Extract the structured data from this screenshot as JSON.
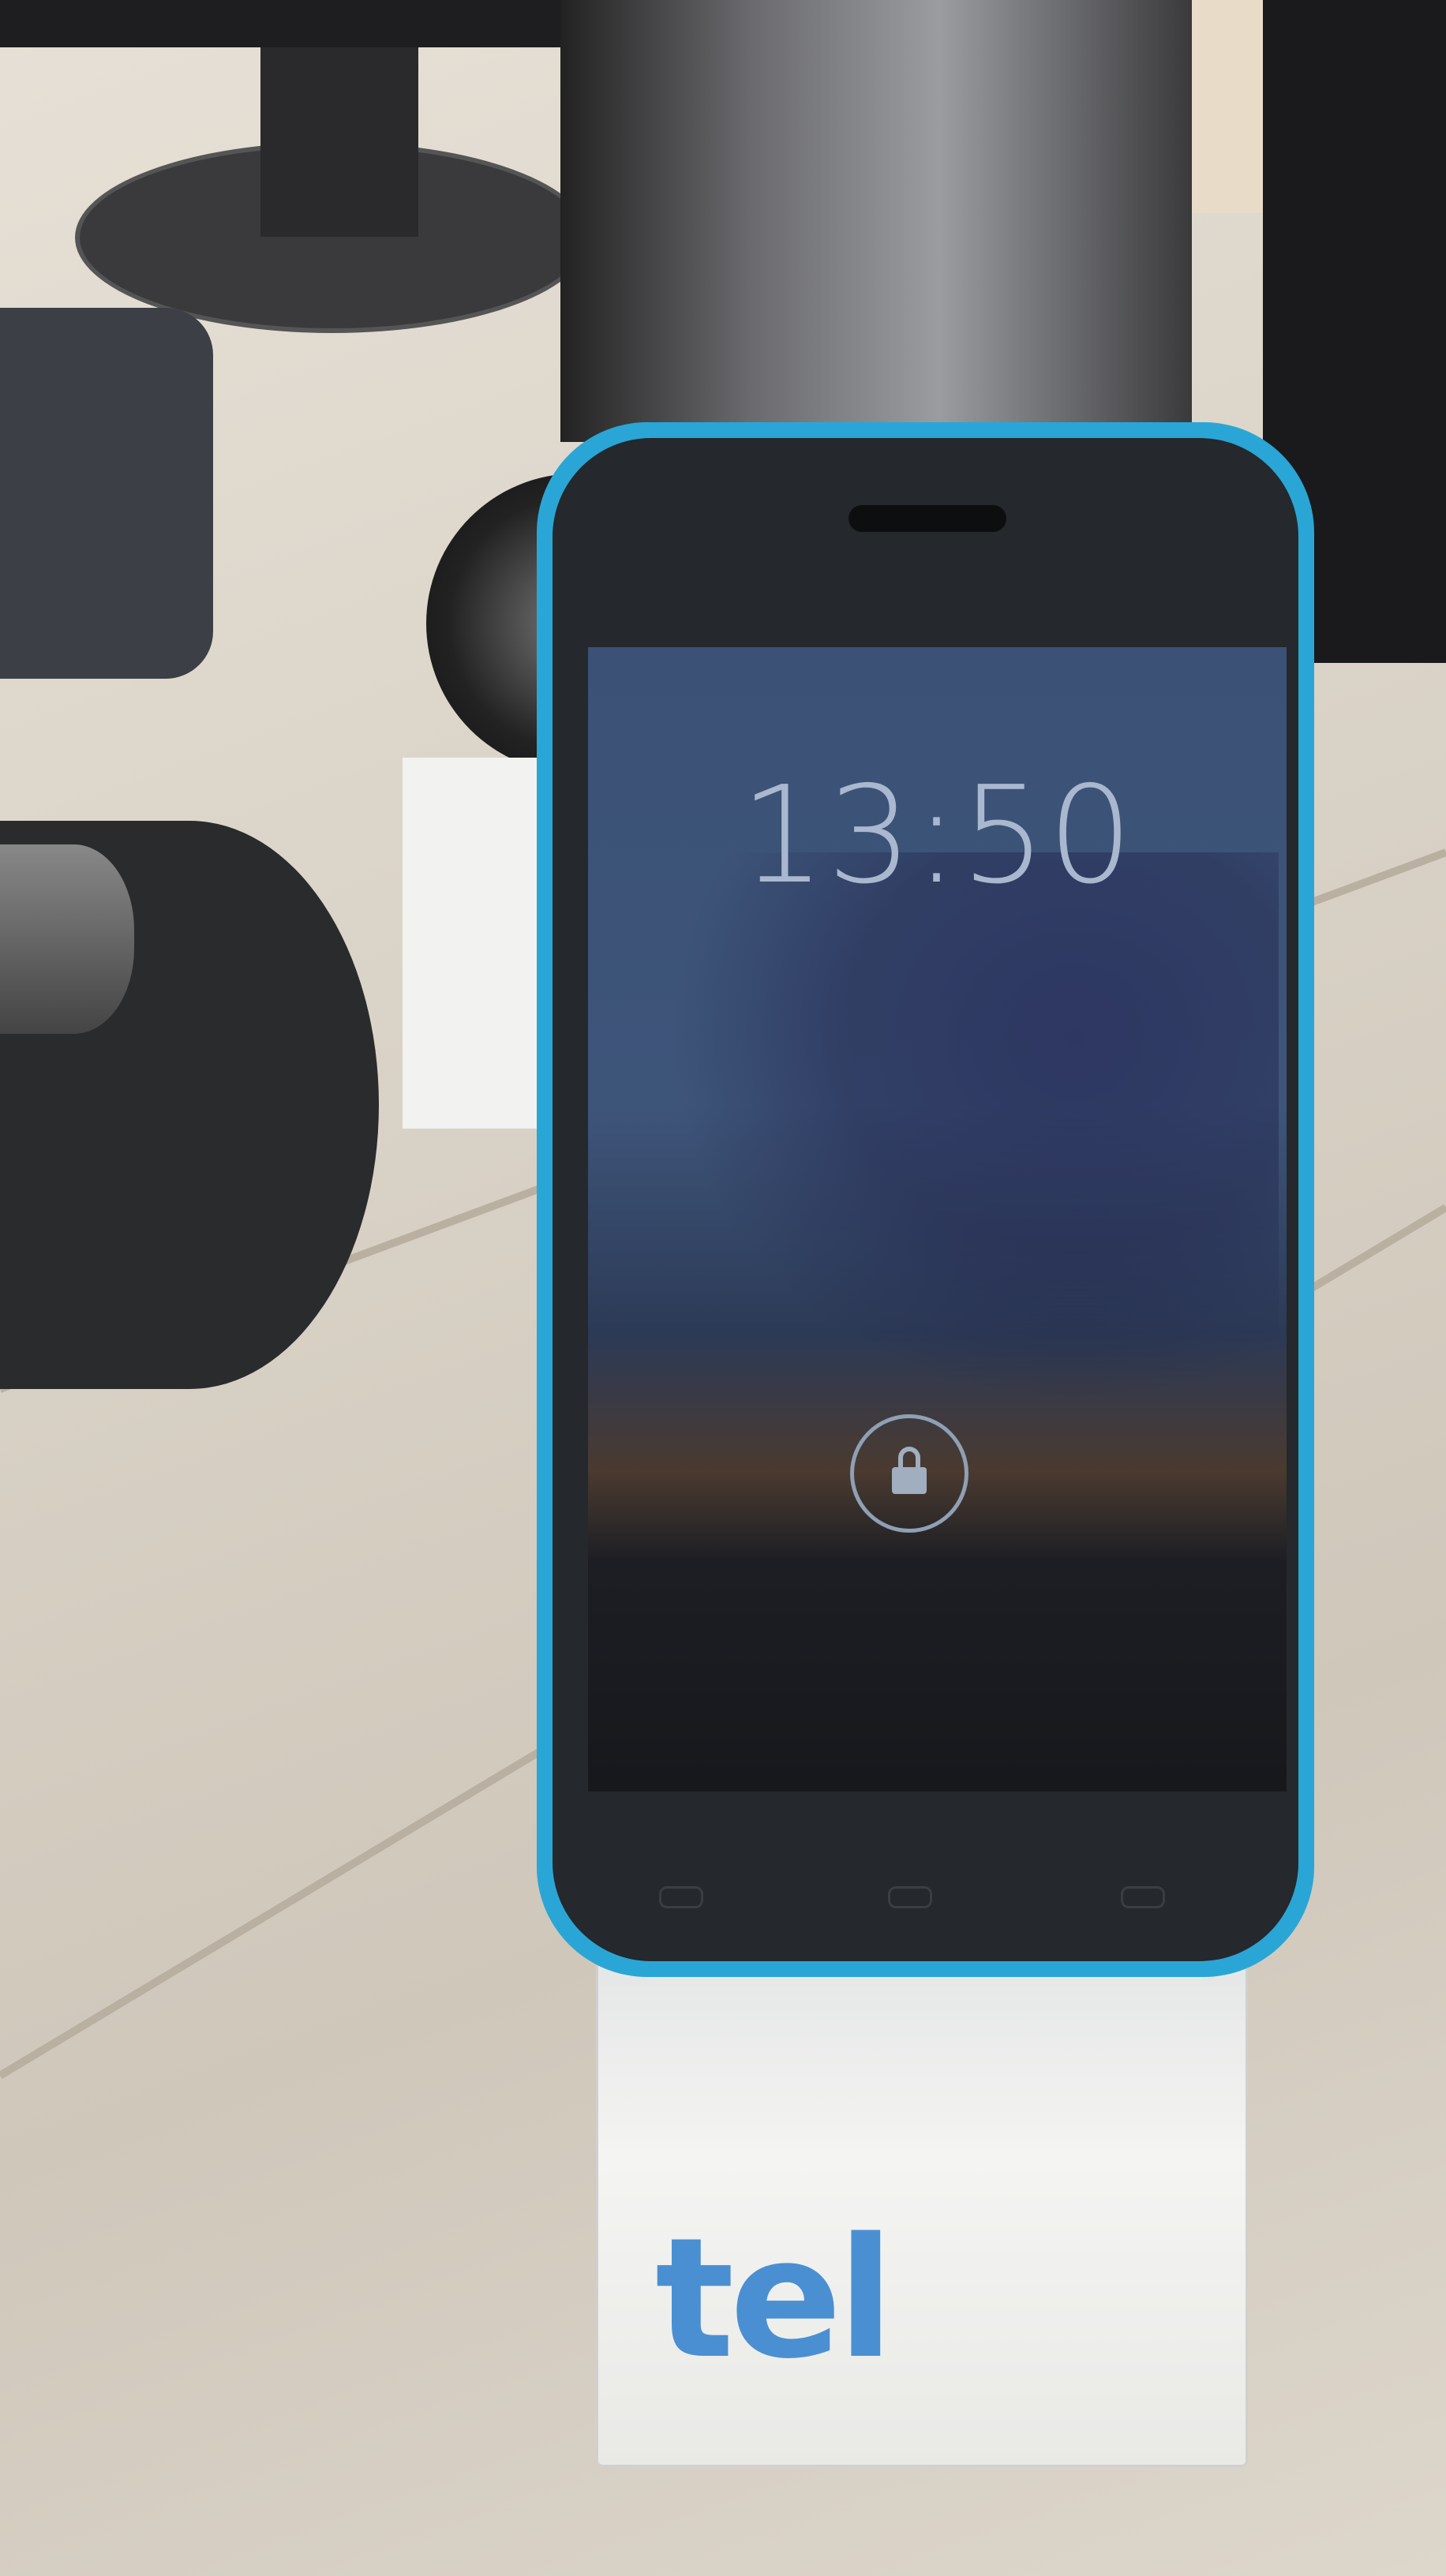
{
  "lockscreen": {
    "time": "13:50",
    "icons": {
      "lock": "lock-icon",
      "back": "back-icon",
      "home": "home-icon",
      "recent": "recent-apps-icon"
    }
  },
  "stand": {
    "logo_text": "tel",
    "logo_color": "#4a8fd2"
  },
  "phone": {
    "body_color": "#2aa6d6"
  }
}
